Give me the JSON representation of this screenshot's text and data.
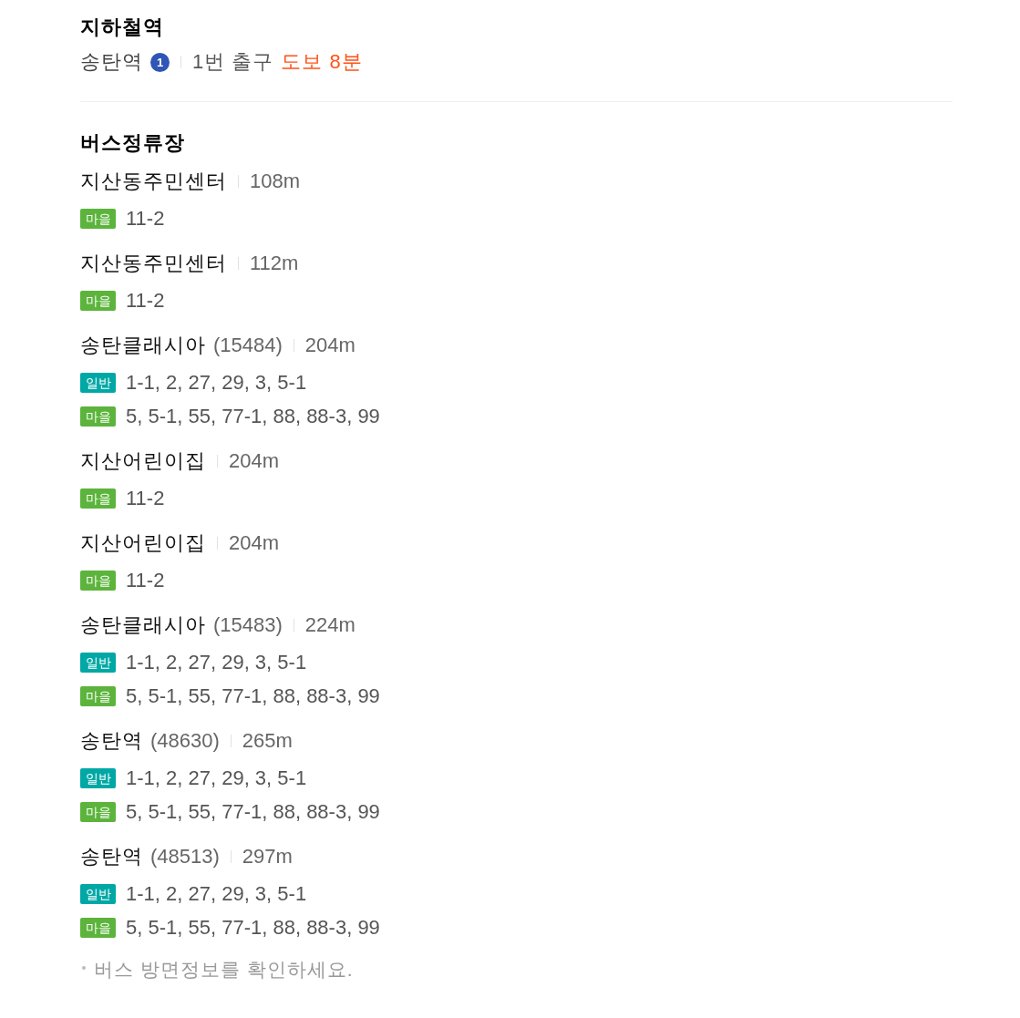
{
  "subway": {
    "title": "지하철역",
    "station": {
      "name": "송탄역",
      "line": "1",
      "exit": "1번 출구",
      "walk_time": "도보 8분"
    }
  },
  "bus": {
    "title": "버스정류장",
    "stops": [
      {
        "name": "지산동주민센터",
        "distance": "108m",
        "routes": [
          {
            "type": "마을",
            "color": "#5cb43c",
            "numbers": "11-2"
          }
        ]
      },
      {
        "name": "지산동주민센터",
        "distance": "112m",
        "routes": [
          {
            "type": "마을",
            "color": "#5cb43c",
            "numbers": "11-2"
          }
        ]
      },
      {
        "name": "송탄클래시아",
        "number": "(15484)",
        "distance": "204m",
        "routes": [
          {
            "type": "일반",
            "color": "#00a8a5",
            "numbers": "1-1, 2, 27, 29, 3, 5-1"
          },
          {
            "type": "마을",
            "color": "#5cb43c",
            "numbers": "5, 5-1, 55, 77-1, 88, 88-3, 99"
          }
        ]
      },
      {
        "name": "지산어린이집",
        "distance": "204m",
        "routes": [
          {
            "type": "마을",
            "color": "#5cb43c",
            "numbers": "11-2"
          }
        ]
      },
      {
        "name": "지산어린이집",
        "distance": "204m",
        "routes": [
          {
            "type": "마을",
            "color": "#5cb43c",
            "numbers": "11-2"
          }
        ]
      },
      {
        "name": "송탄클래시아",
        "number": "(15483)",
        "distance": "224m",
        "routes": [
          {
            "type": "일반",
            "color": "#00a8a5",
            "numbers": "1-1, 2, 27, 29, 3, 5-1"
          },
          {
            "type": "마을",
            "color": "#5cb43c",
            "numbers": "5, 5-1, 55, 77-1, 88, 88-3, 99"
          }
        ]
      },
      {
        "name": "송탄역",
        "number": "(48630)",
        "distance": "265m",
        "routes": [
          {
            "type": "일반",
            "color": "#00a8a5",
            "numbers": "1-1, 2, 27, 29, 3, 5-1"
          },
          {
            "type": "마을",
            "color": "#5cb43c",
            "numbers": "5, 5-1, 55, 77-1, 88, 88-3, 99"
          }
        ]
      },
      {
        "name": "송탄역",
        "number": "(48513)",
        "distance": "297m",
        "routes": [
          {
            "type": "일반",
            "color": "#00a8a5",
            "numbers": "1-1, 2, 27, 29, 3, 5-1"
          },
          {
            "type": "마을",
            "color": "#5cb43c",
            "numbers": "5, 5-1, 55, 77-1, 88, 88-3, 99"
          }
        ]
      }
    ]
  },
  "note": {
    "text": "버스 방면정보를 확인하세요."
  }
}
